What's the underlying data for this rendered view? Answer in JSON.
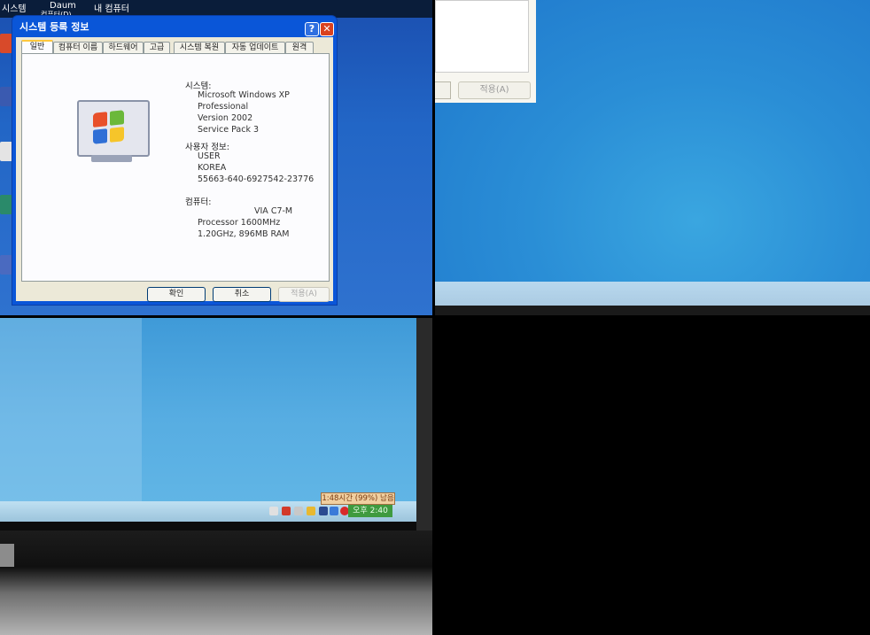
{
  "desktop": {
    "icon_labels": [
      "시스템",
      "Daum",
      "내 컴퓨터"
    ],
    "small_label": "컴퓨터(D)"
  },
  "dialog": {
    "title": "시스템 등록 정보",
    "tabs": [
      "일반",
      "컴퓨터 이름",
      "하드웨어",
      "고급",
      "시스템 복원",
      "자동 업데이트",
      "원격"
    ],
    "system_heading": "시스템:",
    "system_lines": [
      "Microsoft Windows XP",
      "Professional",
      "Version 2002",
      "Service Pack 3"
    ],
    "user_heading": "사용자 정보:",
    "user_lines": [
      "USER",
      "KOREA",
      "55663-640-6927542-23776"
    ],
    "computer_heading": "컴퓨터:",
    "computer_lines": [
      "VIA C7-M",
      "Processor 1600MHz",
      "1.20GHz, 896MB RAM"
    ],
    "ok_label": "확인",
    "cancel_label": "취소",
    "apply_label": "적용(A)"
  },
  "panel2": {
    "apply_label": "적용(A)"
  },
  "tray": {
    "battery_balloon": "1:48시간 (99%) 남음",
    "clock": "오후 2:40"
  }
}
